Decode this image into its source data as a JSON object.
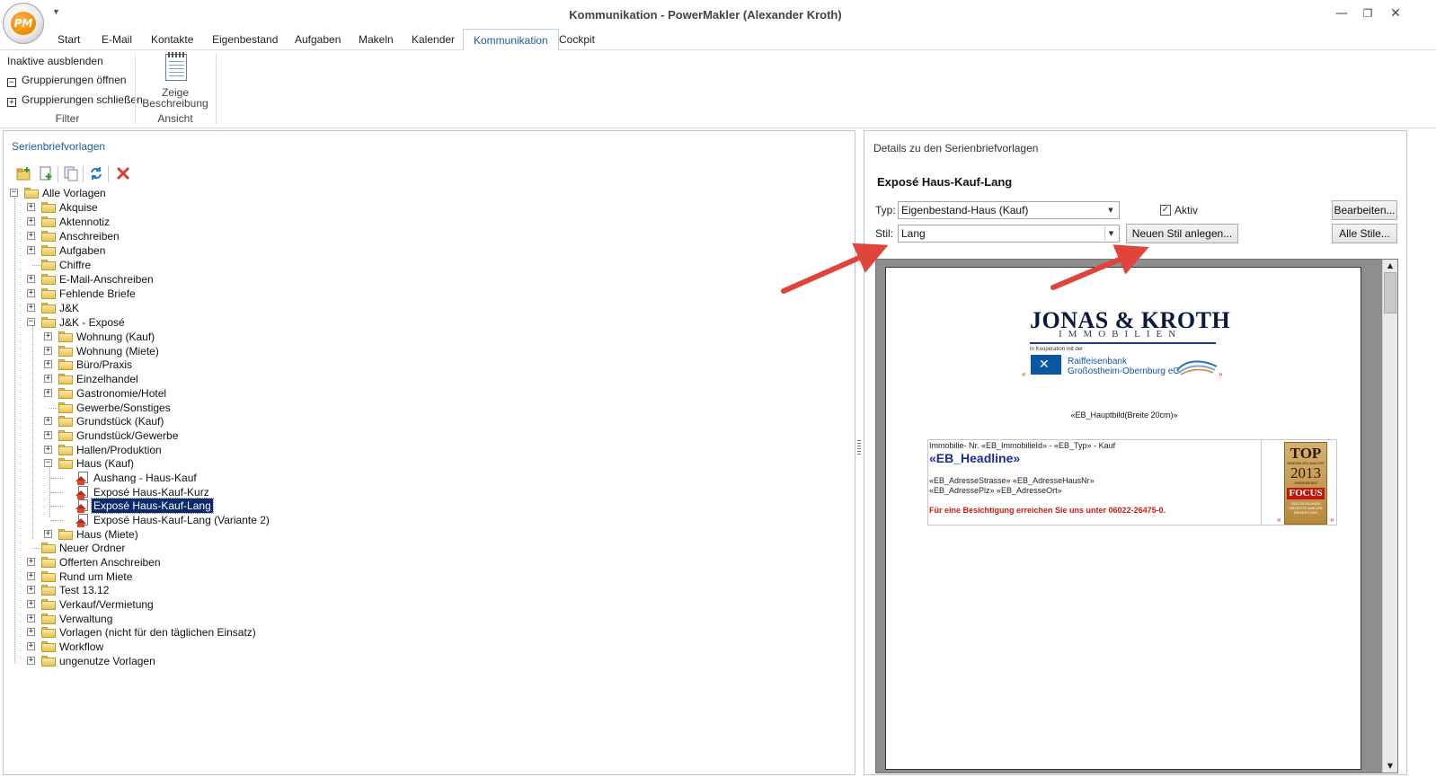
{
  "window": {
    "title": "Kommunikation - PowerMakler (Alexander Kroth)",
    "logo_text": "PM",
    "qat_arrow": "▼",
    "min": "—",
    "max": "❐",
    "close": "✕"
  },
  "ribbon": {
    "tabs": [
      "Start",
      "E-Mail",
      "Kontakte",
      "Eigenbestand",
      "Aufgaben",
      "Makeln",
      "Kalender",
      "Kommunikation",
      "Cockpit"
    ],
    "active_tab": "Kommunikation",
    "filter": {
      "inaktive": "Inaktive ausblenden",
      "open": "Gruppierungen öffnen",
      "close": "Gruppierungen schließen",
      "open_sym": "−",
      "close_sym": "+",
      "group": "Filter"
    },
    "ansicht": {
      "zeige1": "Zeige",
      "zeige2": "Beschreibung",
      "group": "Ansicht"
    }
  },
  "left": {
    "title": "Serienbriefvorlagen",
    "toolbar_icons": [
      "new-folder-icon",
      "new-document-icon",
      "copy-icon",
      "refresh-icon",
      "delete-icon"
    ],
    "tree": {
      "root": "Alle Vorlagen",
      "akquise": "Akquise",
      "aktennotiz": "Aktennotiz",
      "anschreiben": "Anschreiben",
      "aufgaben": "Aufgaben",
      "chiffre": "Chiffre",
      "email": "E-Mail-Anschreiben",
      "fehlende": "Fehlende Briefe",
      "jk": "J&K",
      "jk_expose": "J&K - Exposé",
      "wohnung_kauf": "Wohnung (Kauf)",
      "wohnung_miete": "Wohnung (Miete)",
      "buero": "Büro/Praxis",
      "einzelhandel": "Einzelhandel",
      "gastro": "Gastronomie/Hotel",
      "gewerbe": "Gewerbe/Sonstiges",
      "grundstueck_kauf": "Grundstück (Kauf)",
      "grundstueck_gewerbe": "Grundstück/Gewerbe",
      "hallen": "Hallen/Produktion",
      "haus_kauf": "Haus (Kauf)",
      "aushang": "Aushang - Haus-Kauf",
      "expose_kurz": "Exposé Haus-Kauf-Kurz",
      "expose_lang": "Exposé Haus-Kauf-Lang",
      "expose_lang2": "Exposé Haus-Kauf-Lang (Variante 2)",
      "haus_miete": "Haus (Miete)",
      "neuer_ordner": "Neuer Ordner",
      "offerten": "Offerten Anschreiben",
      "rund": "Rund um Miete",
      "test": "Test 13.12",
      "verkauf": "Verkauf/Vermietung",
      "verwaltung": "Verwaltung",
      "vorlagen_nicht": "Vorlagen (nicht für den täglichen Einsatz)",
      "workflow": "Workflow",
      "ungenutzte": "ungenutze Vorlagen"
    }
  },
  "right": {
    "title": "Details zu den Serienbriefvorlagen",
    "doc_name": "Exposé Haus-Kauf-Lang",
    "typ_label": "Typ:",
    "typ_value": "Eigenbestand-Haus (Kauf)",
    "stil_label": "Stil:",
    "stil_value": "Lang",
    "aktiv_label": "Aktiv",
    "aktiv_checked": "✓",
    "btn_bearbeiten": "Bearbeiten...",
    "btn_alle_stile": "Alle Stile...",
    "btn_neuer_stil": "Neuen Stil anlegen...",
    "dropdown_arrow": "▼"
  },
  "preview": {
    "logo_name": "JONAS & KROTH",
    "logo_sub": "IMMOBILIEN",
    "koop": "In Kooperation mit der",
    "bank1": "Raiffeisenbank",
    "bank2": "Großostheim-Obernburg eG",
    "bank_x": "✕",
    "chev": "«",
    "chev_r": "»",
    "hauptbild": "«EB_Hauptbild(Breite 20cm)»",
    "line1": "Immobilie- Nr. «EB_ImmobilieId» - «EB_Typ» - Kauf",
    "headline": "«EB_Headline»",
    "addr1": "«EB_AdresseStrasse» «EB_AdresseHausNr»",
    "addr2": "«EB_AdressePlz» «EB_AdresseOrt»",
    "visit": "Für eine Besichtigung erreichen Sie uns unter 06022-26475-0.",
    "badge_top": "TOP",
    "badge_sub1": "IMMOBILIEN MAKLER",
    "badge_year": "2013",
    "badge_city": "OBERNBURG",
    "badge_focus": "FOCUS",
    "badge_small": "DEUTSCHLANDS GRÖSSTE MAKLER BEWERTUNG",
    "scroll_up": "▲",
    "scroll_down": "▼"
  },
  "colors": {
    "accent_blue": "#1f5fa8",
    "selection": "#0b2a6b",
    "arrow_red": "#e0443a",
    "headline_blue": "#1a2c9a",
    "visit_red": "#d11a0e"
  }
}
